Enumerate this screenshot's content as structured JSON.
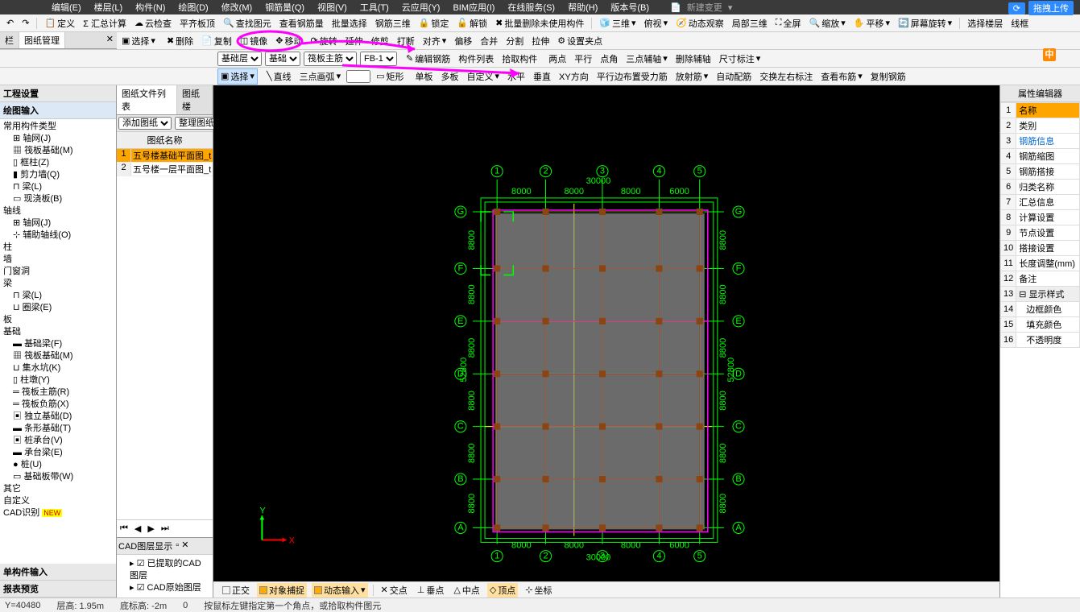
{
  "menu": {
    "items": [
      "编辑(E)",
      "楼层(L)",
      "构件(N)",
      "绘图(D)",
      "修改(M)",
      "钢筋量(Q)",
      "视图(V)",
      "工具(T)",
      "云应用(Y)",
      "BIM应用(I)",
      "在线服务(S)",
      "帮助(H)",
      "版本号(B)"
    ],
    "new_change": "新建变更",
    "upload": "拖拽上传"
  },
  "toolbar1": {
    "items": [
      "定义",
      "Σ 汇总计算",
      "云检查",
      "平齐板顶",
      "查找图元",
      "查看钢筋量",
      "批量选择",
      "钢筋三维",
      "锁定",
      "解锁",
      "批量删除未使用构件",
      "三维",
      "俯视",
      "动态观察",
      "局部三维",
      "全屏",
      "缩放",
      "平移",
      "屏幕旋转",
      "选择楼层",
      "线框"
    ]
  },
  "toolbar2": {
    "items": [
      "选择",
      "删除",
      "复制",
      "镜像",
      "移动",
      "旋转",
      "延伸",
      "修剪",
      "打断",
      "对齐",
      "偏移",
      "合并",
      "分割",
      "拉伸",
      "设置夹点"
    ]
  },
  "toolbar3": {
    "sel_basic_layer": "基础层",
    "sel_basic": "基础",
    "sel_raft": "筏板主筋",
    "sel_fb": "FB-1",
    "items": [
      "编辑钢筋",
      "构件列表",
      "拾取构件",
      "两点",
      "平行",
      "点角",
      "三点辅轴",
      "删除辅轴",
      "尺寸标注"
    ]
  },
  "toolbar4": {
    "select": "选择",
    "items": [
      "直线",
      "三点画弧",
      "",
      "矩形",
      "单板",
      "多板",
      "自定义",
      "水平",
      "垂直",
      "XY方向",
      "平行边布置受力筋",
      "放射筋",
      "自动配筋",
      "交换左右标注",
      "查看布筋",
      "复制钢筋"
    ]
  },
  "left_tabs": {
    "proj": "工程设置",
    "draw": "绘图输入"
  },
  "tree": {
    "cat_common": "常用构件类型",
    "items_common": [
      "轴网(J)",
      "筏板基础(M)",
      "框柱(Z)",
      "剪力墙(Q)",
      "梁(L)",
      "现浇板(B)"
    ],
    "cat_axis": "轴线",
    "items_axis": [
      "轴网(J)",
      "辅助轴线(O)"
    ],
    "cat_col": "柱",
    "cat_wall": "墙",
    "cat_opening": "门窗洞",
    "cat_beam": "梁",
    "items_beam": [
      "梁(L)",
      "圈梁(E)"
    ],
    "cat_slab": "板",
    "cat_found": "基础",
    "items_found": [
      "基础梁(F)",
      "筏板基础(M)",
      "集水坑(K)",
      "柱墩(Y)",
      "筏板主筋(R)",
      "筏板负筋(X)",
      "独立基础(D)",
      "条形基础(T)",
      "桩承台(V)",
      "承台梁(E)",
      "桩(U)",
      "基础板带(W)"
    ],
    "cat_other": "其它",
    "cat_custom": "自定义",
    "cat_cad": "CAD识别",
    "new_badge": "NEW"
  },
  "mid": {
    "tab1": "图纸文件列表",
    "tab2": "图纸楼",
    "add": "添加图纸",
    "manage": "整理图纸",
    "col": "图纸名称",
    "rows": [
      "五号楼基础平面图_t",
      "五号楼一层平面图_t"
    ]
  },
  "cad": {
    "title": "CAD图层显示",
    "items": [
      "已提取的CAD图层",
      "CAD原始图层"
    ]
  },
  "right": {
    "title": "属性编辑器",
    "rows": [
      [
        "1",
        "名称"
      ],
      [
        "2",
        "类别"
      ],
      [
        "3",
        "钢筋信息"
      ],
      [
        "4",
        "钢筋缩图"
      ],
      [
        "5",
        "钢筋搭接"
      ],
      [
        "6",
        "归类名称"
      ],
      [
        "7",
        "汇总信息"
      ],
      [
        "8",
        "计算设置"
      ],
      [
        "9",
        "节点设置"
      ],
      [
        "10",
        "搭接设置"
      ],
      [
        "11",
        "长度调整(mm)"
      ],
      [
        "12",
        "备注"
      ],
      [
        "13",
        "显示样式"
      ],
      [
        "14",
        "边框颜色"
      ],
      [
        "15",
        "填充颜色"
      ],
      [
        "16",
        "不透明度"
      ]
    ]
  },
  "bottom_tabs": {
    "single": "单构件输入",
    "report": "报表预览"
  },
  "bottom_toolbar": {
    "items": [
      "正交",
      "对象捕捉",
      "动态输入",
      "交点",
      "垂点",
      "中点",
      "顶点",
      "坐标"
    ]
  },
  "status": {
    "y": "Y=40480",
    "floor": "层高: 1.95m",
    "bottom": "底标高: -2m",
    "zero": "0",
    "hint": "按鼠标左键指定第一个角点，或拾取构件图元"
  },
  "canvas": {
    "dims_top": [
      "8000",
      "8000",
      "8000",
      "6000"
    ],
    "dim_total": "30000",
    "dims_left": [
      "8800",
      "8800",
      "8800",
      "8800",
      "8800",
      "8800"
    ],
    "dim_left_total": "52800",
    "grid_h": [
      "A",
      "B",
      "C",
      "D",
      "E",
      "F",
      "G"
    ],
    "grid_v": [
      "1",
      "2",
      "3",
      "4",
      "5"
    ]
  },
  "orange_badge": "中"
}
